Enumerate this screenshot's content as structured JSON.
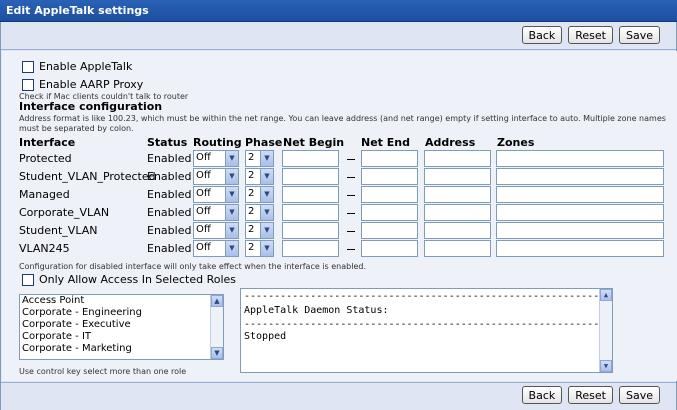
{
  "window": {
    "title": "Edit AppleTalk settings"
  },
  "toolbar": {
    "back_label": "Back",
    "reset_label": "Reset",
    "save_label": "Save"
  },
  "options": {
    "enable_appletalk": "Enable AppleTalk",
    "enable_aarp_proxy": "Enable AARP Proxy",
    "aarp_hint": "Check if Mac clients couldn't talk to router"
  },
  "interface_config": {
    "heading": "Interface configuration",
    "note": "Address format is like 100.23, which must be within the net range. You can leave address (and net range) empty if setting interface to auto. Multiple zone names must be separated by colon.",
    "columns": [
      "Interface",
      "Status",
      "Routing",
      "Phase",
      "Net Begin",
      "Net End",
      "Address",
      "Zones"
    ],
    "rows": [
      {
        "name": "Protected",
        "status": "Enabled",
        "routing": "Off",
        "phase": "2"
      },
      {
        "name": "Student_VLAN_Protected",
        "status": "Enabled",
        "routing": "Off",
        "phase": "2"
      },
      {
        "name": "Managed",
        "status": "Enabled",
        "routing": "Off",
        "phase": "2"
      },
      {
        "name": "Corporate_VLAN",
        "status": "Enabled",
        "routing": "Off",
        "phase": "2"
      },
      {
        "name": "Student_VLAN",
        "status": "Enabled",
        "routing": "Off",
        "phase": "2"
      },
      {
        "name": "VLAN245",
        "status": "Enabled",
        "routing": "Off",
        "phase": "2"
      }
    ],
    "footer_note": "Configuration for disabled interface will only take effect when the interface is enabled."
  },
  "roles": {
    "only_allow_label": "Only Allow Access In Selected Roles",
    "items": [
      "Access Point",
      "Corporate - Engineering",
      "Corporate - Executive",
      "Corporate - IT",
      "Corporate - Marketing"
    ],
    "hint": "Use control key select more than one role"
  },
  "daemon": {
    "separator": "-----------------------------------------------------------",
    "status_label": "AppleTalk Daemon Status:",
    "status_value": "Stopped"
  },
  "icons": {
    "dropdown": "chevron-down-icon",
    "scroll_up": "arrow-up-icon",
    "scroll_down": "arrow-down-icon"
  },
  "colors": {
    "titlebar": "#2a62b6",
    "panel": "#dfe5f3",
    "content": "#eef1f8",
    "border": "#7f9db9"
  }
}
